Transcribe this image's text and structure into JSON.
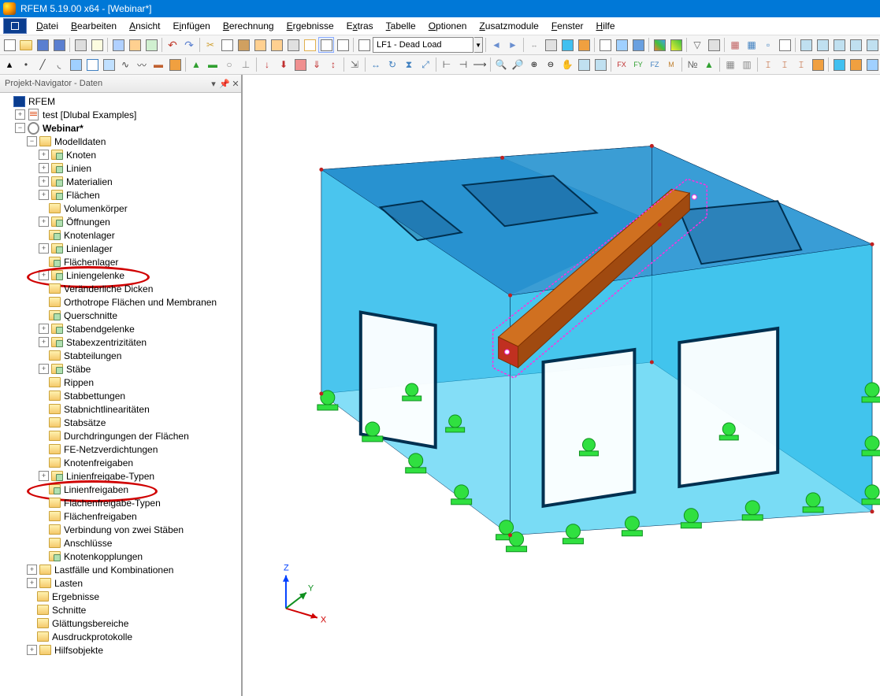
{
  "title": "RFEM 5.19.00 x64 - [Webinar*]",
  "menus": [
    "Datei",
    "Bearbeiten",
    "Ansicht",
    "Einfügen",
    "Berechnung",
    "Ergebnisse",
    "Extras",
    "Tabelle",
    "Optionen",
    "Zusatzmodule",
    "Fenster",
    "Hilfe"
  ],
  "lf_preview": "⊕",
  "lf_value": "LF1 - Dead Load",
  "nav_title": "Projekt-Navigator - Daten",
  "tree": {
    "root": "RFEM",
    "proj1": "test [Dlubal Examples]",
    "proj2": "Webinar*",
    "modelldaten": "Modelldaten",
    "items": [
      "Knoten",
      "Linien",
      "Materialien",
      "Flächen",
      "Volumenkörper",
      "Öffnungen",
      "Knotenlager",
      "Linienlager",
      "Flächenlager",
      "Liniengelenke",
      "Veränderliche Dicken",
      "Orthotrope Flächen und Membranen",
      "Querschnitte",
      "Stabendgelenke",
      "Stabexzentrizitäten",
      "Stabteilungen",
      "Stäbe",
      "Rippen",
      "Stabbettungen",
      "Stabnichtlinearitäten",
      "Stabsätze",
      "Durchdringungen der Flächen",
      "FE-Netzverdichtungen",
      "Knotenfreigaben",
      "Linienfreigabe-Typen",
      "Linienfreigaben",
      "Flächenfreigabe-Typen",
      "Flächenfreigaben",
      "Verbindung von zwei Stäben",
      "Anschlüsse",
      "Knotenkopplungen"
    ],
    "lastfaelle": "Lastfälle und Kombinationen",
    "lasten": "Lasten",
    "ergebnisse": "Ergebnisse",
    "schnitte": "Schnitte",
    "glaettung": "Glättungsbereiche",
    "ausdruck": "Ausdruckprotokolle",
    "hilfsobjekte": "Hilfsobjekte"
  },
  "axes": {
    "x": "X",
    "y": "Y",
    "z": "Z"
  }
}
